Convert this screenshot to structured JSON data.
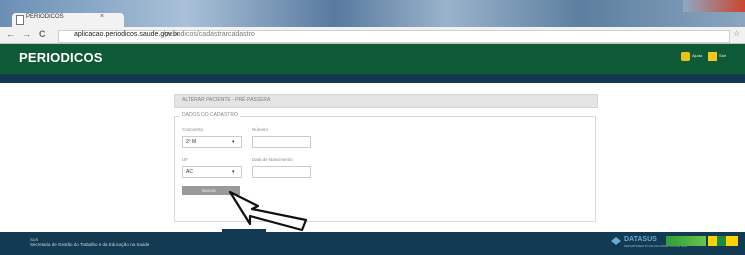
{
  "browser": {
    "tab_title": "PERIODICOS",
    "tab_close": "×",
    "back": "←",
    "forward": "→",
    "reload": "C",
    "url_host": "aplicacao.periodicos.saude.gov.br",
    "url_path": "/periodicos/cadastrarcadastro",
    "star": "☆"
  },
  "header": {
    "title": "PERIODICOS",
    "link1": "Ajuda",
    "link2": "Sair"
  },
  "form": {
    "title": "ALTERAR PACIENTE - PRÉ-PASSERA",
    "legend": "DADOS DO CADASTRO",
    "label_a": "Concentra",
    "select_a_value": "2º M",
    "label_b": "Número",
    "label_c": "UF",
    "select_c_value": "AC",
    "label_d": "Data de Nascimento",
    "search_button": "Buscar"
  },
  "footer": {
    "line1": "SUS",
    "line2": "Secretaria de Gestão do Trabalho e da Educação na Saúde",
    "datasus": "DATASUS",
    "datasus_sub": "DEPARTAMENTO DE INFORMÁTICA DO SUS"
  },
  "colors": {
    "header_green": "#0f5a36",
    "footer_navy": "#123a52"
  }
}
